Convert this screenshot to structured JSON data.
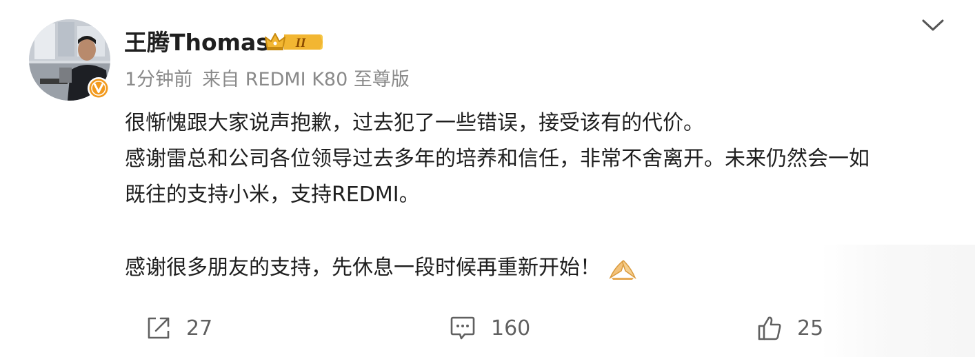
{
  "post": {
    "author": {
      "name": "王腾Thomas",
      "avatar_icon": "profile-photo",
      "verified_badge": "V",
      "level_badge": "II"
    },
    "meta": {
      "time": "1分钟前",
      "source": "来自 REDMI K80 至尊版"
    },
    "content": {
      "lines": [
        "很惭愧跟大家说声抱歉，过去犯了一些错误，接受该有的代价。",
        "感谢雷总和公司各位领导过去多年的培养和信任，非常不舍离开。未来仍然会一如",
        "既往的支持小米，支持REDMI。",
        "感谢很多朋友的支持，先休息一段时候再重新开始！"
      ],
      "emoji": "praying-hands"
    },
    "actions": {
      "repost_count": "27",
      "comment_count": "160",
      "like_count": "25"
    }
  },
  "colors": {
    "text": "#1f1f1f",
    "meta_text": "#8a8a8a",
    "icon": "#606060",
    "verified_orange": "#f29a1e",
    "crown_gold": "#f2b632"
  }
}
